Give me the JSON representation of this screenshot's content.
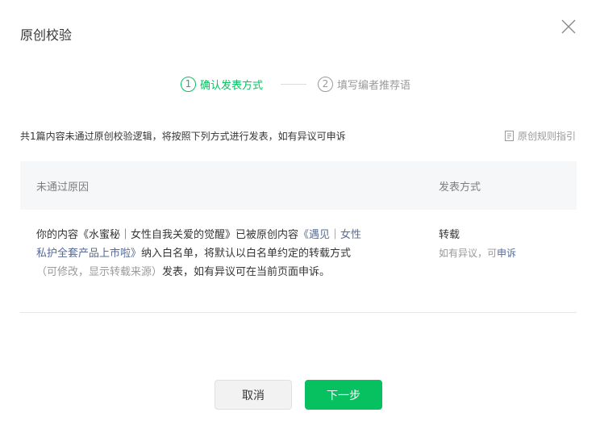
{
  "dialog": {
    "title": "原创校验"
  },
  "steps": [
    {
      "num": "1",
      "label": "确认发表方式"
    },
    {
      "num": "2",
      "label": "填写编者推荐语"
    }
  ],
  "notice": "共1篇内容未通过原创校验逻辑，将按照下列方式进行发表，如有异议可申诉",
  "rules_link": "原创规则指引",
  "table": {
    "headers": [
      "未通过原因",
      "发表方式"
    ],
    "row": {
      "reason_pre": "你的内容《水蜜秘｜女性自我关爱的觉醒》已被原创内容",
      "reason_link": "《遇见｜女性私护全套产品上市啦》",
      "reason_mid": "纳入白名单，将默认以白名单约定的转载方式",
      "reason_muted": "（可修改，显示转载来源）",
      "reason_post": "发表，如有异议可在当前页面申诉。",
      "method_title": "转载",
      "method_sub": "如有异议，可",
      "method_link": "申诉"
    }
  },
  "buttons": {
    "cancel": "取消",
    "next": "下一步"
  },
  "colors": {
    "accent": "#07c160",
    "link": "#576b95",
    "muted": "#9a9a9a"
  }
}
